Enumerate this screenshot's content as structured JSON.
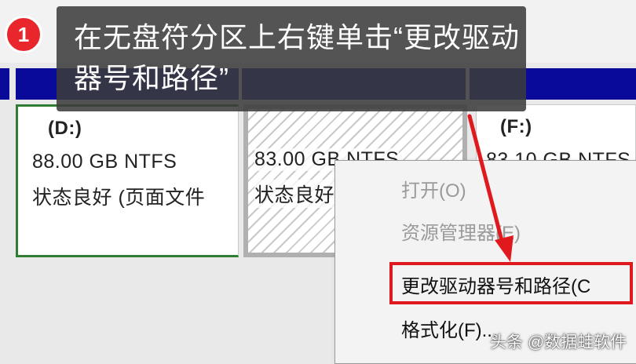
{
  "callout": {
    "step_number": "1",
    "text": "在无盘符分区上右键单击“更改驱动器号和路径”"
  },
  "partitions": [
    {
      "letter": "(D:)",
      "size": "88.00 GB NTFS",
      "status": "状态良好 (页面文件"
    },
    {
      "letter": "",
      "size": "83.00 GB NTFS",
      "status": "状态良好"
    },
    {
      "letter": "(F:)",
      "size": "83.10 GB NTFS",
      "status": ""
    }
  ],
  "context_menu": {
    "items": [
      {
        "label": "打开(O)",
        "enabled": false
      },
      {
        "label": "资源管理器(E)",
        "enabled": false
      },
      {
        "label": "更改驱动器号和路径(C",
        "enabled": true,
        "highlighted": true
      },
      {
        "label": "格式化(F)...",
        "enabled": true
      }
    ]
  },
  "watermark": "头条 @数据蛙软件",
  "colors": {
    "partition_header": "#0a0a9a",
    "selected_border": "#2e7d32",
    "highlight_red": "#e0191f",
    "badge_red": "#e8262c"
  },
  "icons": [
    "step-badge",
    "red-arrow"
  ]
}
